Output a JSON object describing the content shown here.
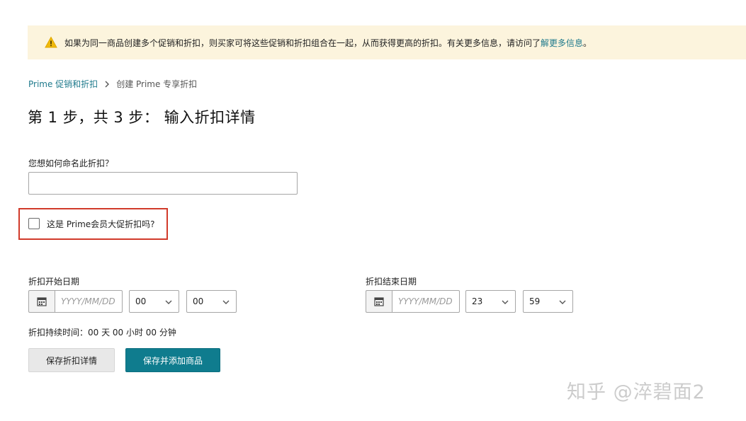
{
  "alert": {
    "text": "如果为同一商品创建多个促销和折扣，则买家可将这些促销和折扣组合在一起，从而获得更高的折扣。有关更多信息，请访问了",
    "link": "解更多信息",
    "suffix": "。",
    "icon": "warning-icon"
  },
  "breadcrumb": {
    "parent": "Prime 促销和折扣",
    "separator": ">",
    "current": "创建 Prime 专享折扣"
  },
  "title": "第 1 步，共 3 步： 输入折扣详情",
  "name_field": {
    "label": "您想如何命名此折扣？",
    "value": "",
    "placeholder": ""
  },
  "prime_day": {
    "label": "这是 Prime会员大促折扣吗?",
    "checked": false
  },
  "start": {
    "label": "折扣开始日期",
    "date_placeholder": "YYYY/MM/DD",
    "hour": "00",
    "minute": "00"
  },
  "end": {
    "label": "折扣结束日期",
    "date_placeholder": "YYYY/MM/DD",
    "hour": "23",
    "minute": "59"
  },
  "duration": "折扣持续时间：00 天 00 小时 00 分钟",
  "buttons": {
    "save_details": "保存折扣详情",
    "save_add": "保存并添加商品"
  },
  "watermark": "知乎 @淬碧面2",
  "colors": {
    "accent": "#0f7c8e",
    "link": "#1f7a8c",
    "alert_bg": "#fcf4dd",
    "highlight_border": "#d13a2a"
  }
}
